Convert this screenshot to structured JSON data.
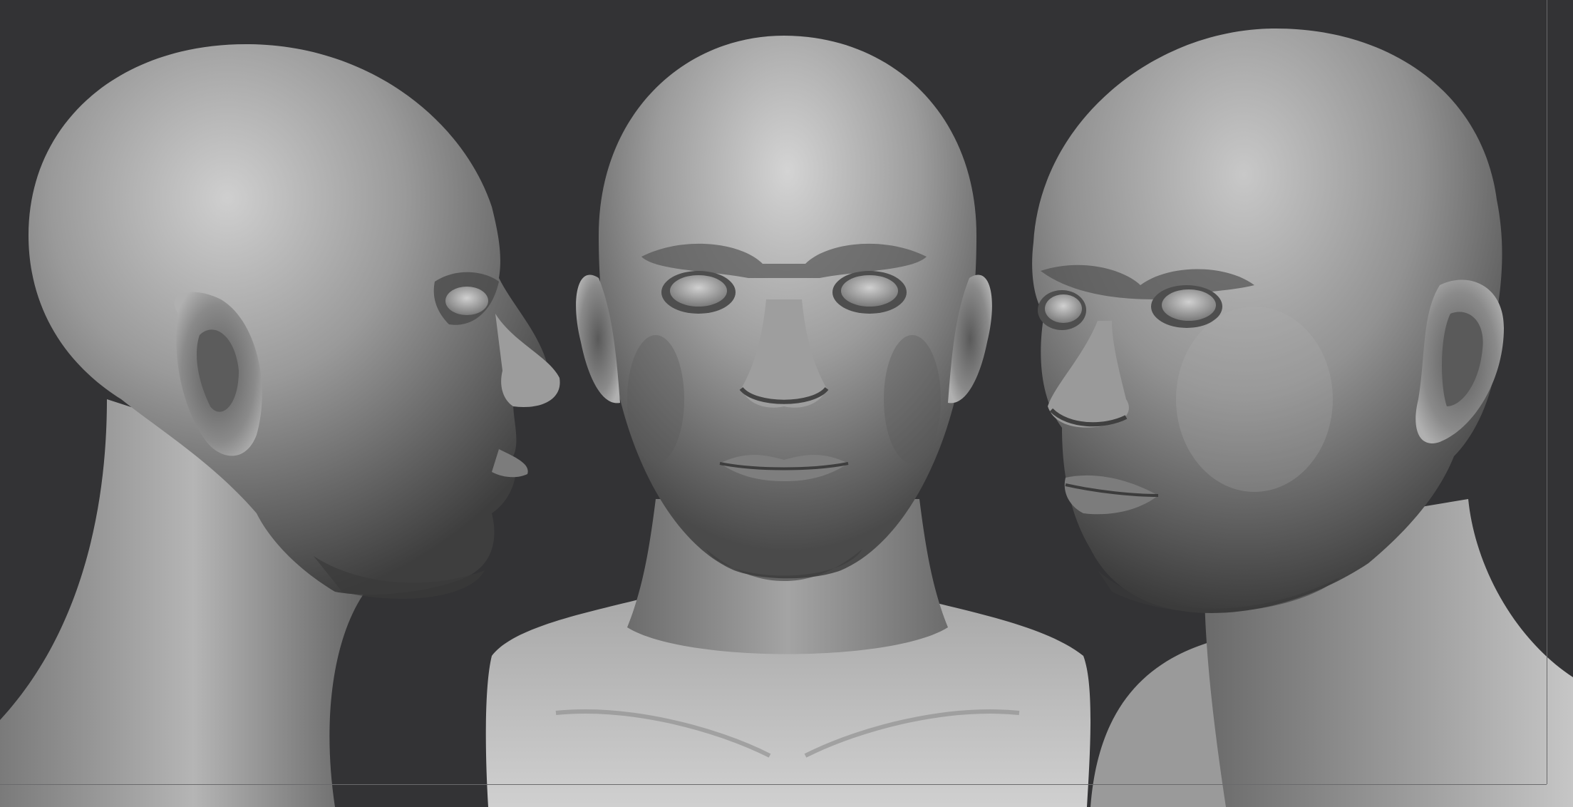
{
  "scene": {
    "background_color": "#333335",
    "material_color": "#8e8e8e",
    "highlight_color": "#d8d8d8",
    "shadow_color": "#2a2a2a",
    "views": [
      {
        "name": "head-side-profile",
        "facing": "right"
      },
      {
        "name": "head-front",
        "facing": "front"
      },
      {
        "name": "head-three-quarter",
        "facing": "left"
      }
    ]
  }
}
